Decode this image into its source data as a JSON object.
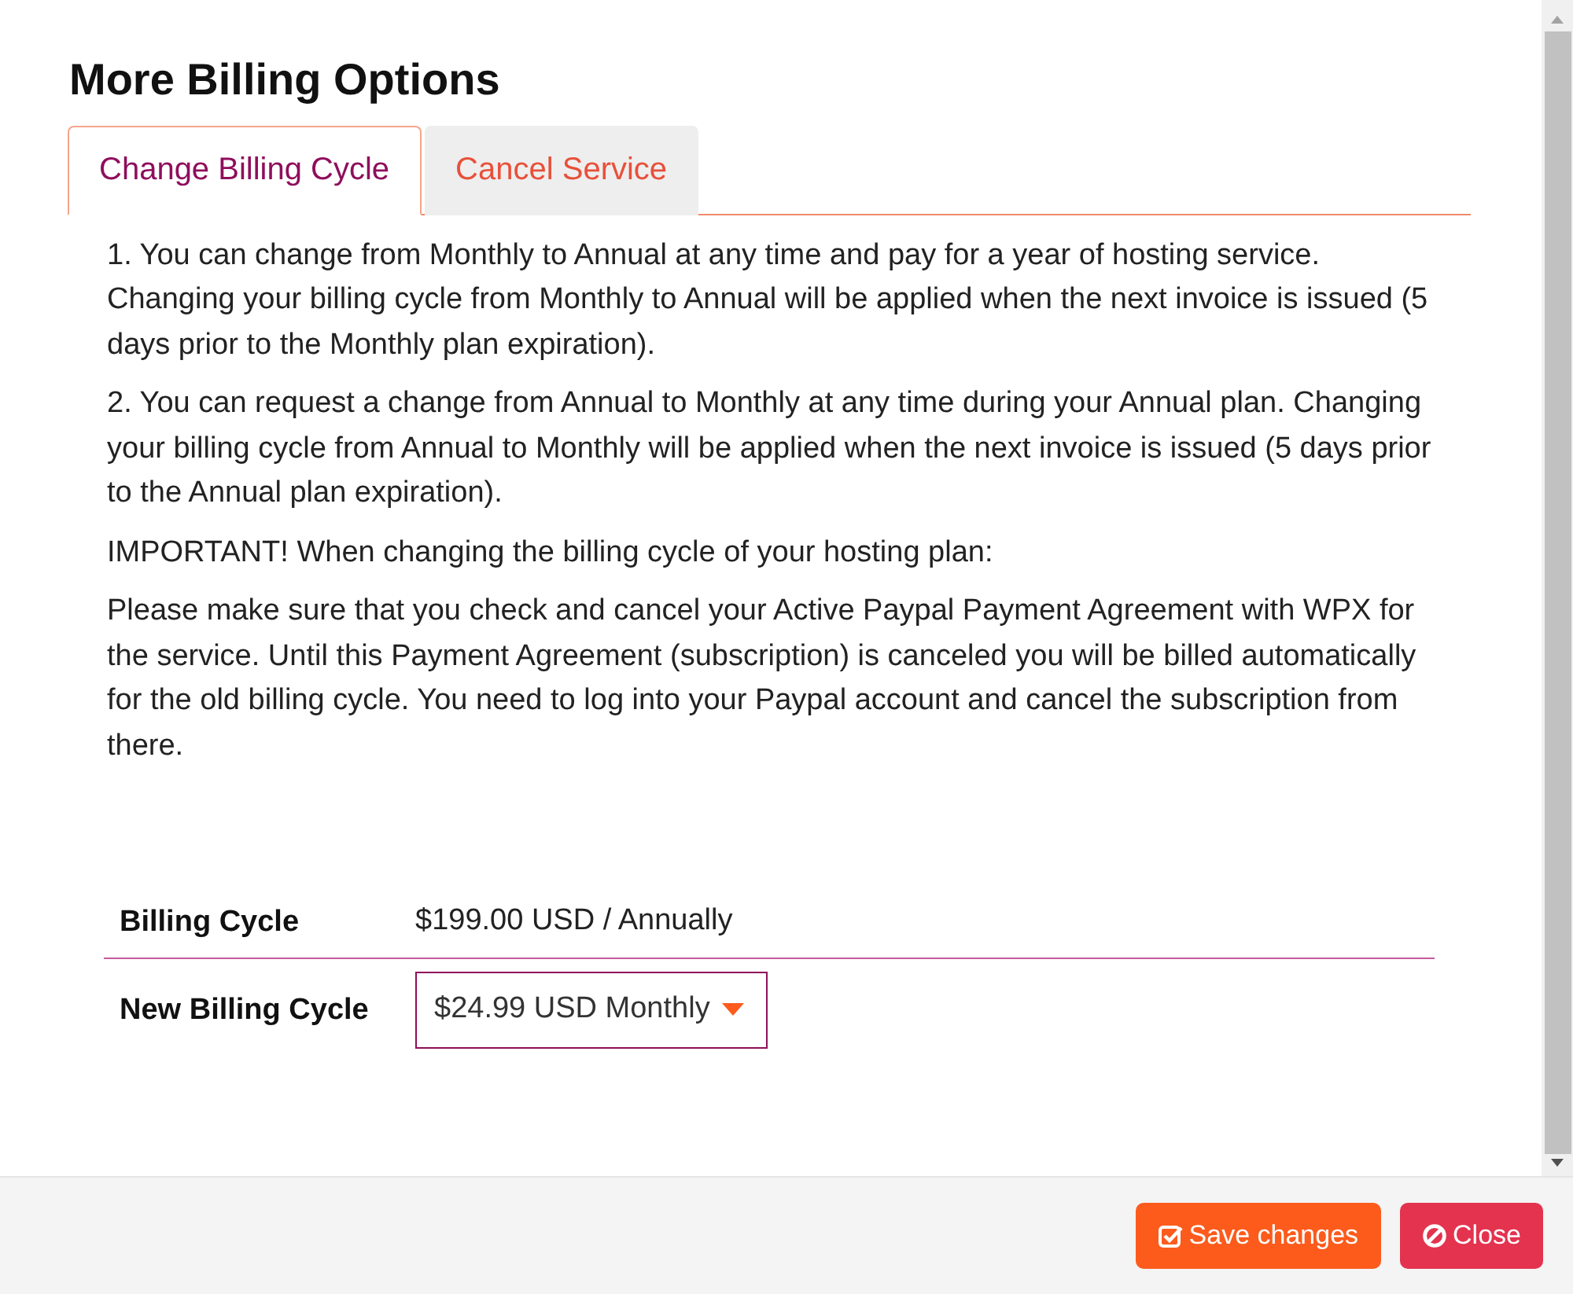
{
  "modal": {
    "title": "More Billing Options"
  },
  "tabs": [
    {
      "label": "Change Billing Cycle",
      "selected": true
    },
    {
      "label": "Cancel Service",
      "selected": false
    }
  ],
  "paragraphs": [
    "1. You can change from Monthly to Annual at any time and pay for a year of hosting service. Changing your billing cycle from Monthly to Annual will be applied when the next invoice is issued (5 days prior to the Monthly plan expiration).",
    "2. You can request a change from Annual to Monthly at any time during your Annual plan. Changing your billing cycle from Annual to Monthly will be applied when the next invoice is issued (5 days prior to the Annual plan expiration).",
    "IMPORTANT! When changing the billing cycle of your hosting plan:",
    "Please make sure that you check and cancel your Active Paypal Payment Agreement with WPX for the service. Until this Payment Agreement (subscription) is canceled you will be billed automatically for the old billing cycle. You need to log into your Paypal account and cancel the subscription from there."
  ],
  "billing_rows": [
    {
      "kind": "text",
      "label": "Billing Cycle",
      "value": "$199.00 USD / Annually"
    },
    {
      "kind": "select",
      "label": "New Billing Cycle",
      "value": "$24.99 USD Monthly"
    }
  ],
  "buttons": [
    {
      "kind": "save",
      "label": "Save changes"
    },
    {
      "kind": "close",
      "label": "Close"
    }
  ]
}
